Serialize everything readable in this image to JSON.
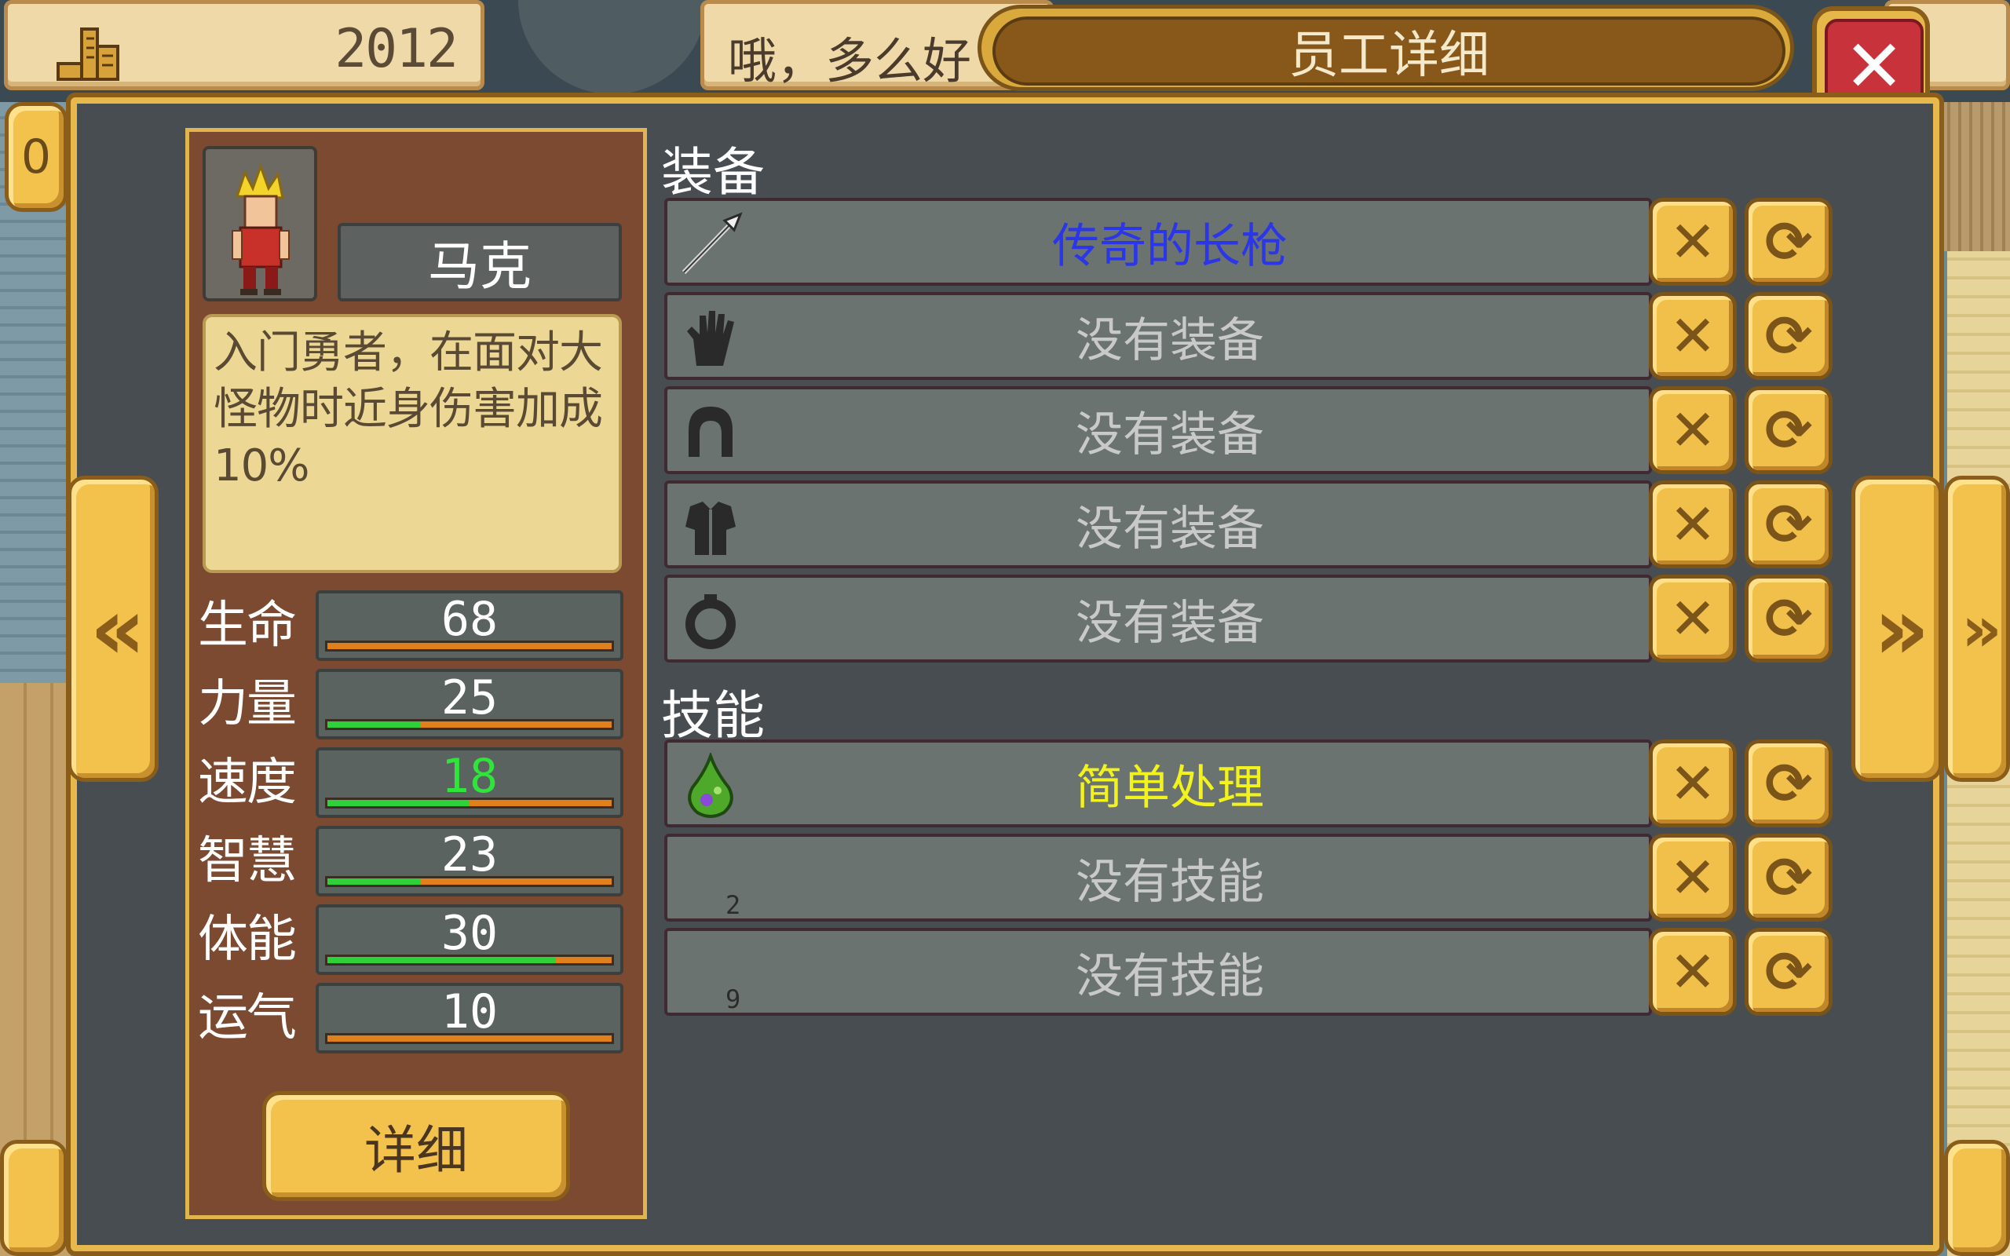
{
  "top_bar": {
    "year": "2012",
    "message": "哦，多么好"
  },
  "dialog": {
    "title": "员工详细",
    "close_symbol": "✕"
  },
  "nav": {
    "prev_symbol": "«",
    "next_symbol": "»",
    "left_edge_text": "0"
  },
  "character": {
    "name": "马克",
    "description": "入门勇者，在面对大怪物时近身伤害加成10%",
    "stats": [
      {
        "label": "生命",
        "value": "68",
        "bar_fraction": 0.0,
        "value_color": "#ffffff"
      },
      {
        "label": "力量",
        "value": "25",
        "bar_fraction": 0.33,
        "value_color": "#ffffff"
      },
      {
        "label": "速度",
        "value": "18",
        "bar_fraction": 0.5,
        "value_color": "#2fe53a"
      },
      {
        "label": "智慧",
        "value": "23",
        "bar_fraction": 0.33,
        "value_color": "#ffffff"
      },
      {
        "label": "体能",
        "value": "30",
        "bar_fraction": 0.8,
        "value_color": "#ffffff"
      },
      {
        "label": "运气",
        "value": "10",
        "bar_fraction": 0.0,
        "value_color": "#ffffff"
      }
    ],
    "detail_button": "详细"
  },
  "equipment": {
    "heading": "装备",
    "slots": [
      {
        "icon": "spear-icon",
        "text": "传奇的长枪",
        "color": "#2a36e8"
      },
      {
        "icon": "glove-icon",
        "text": "没有装备",
        "color": "#c9c9c9"
      },
      {
        "icon": "helmet-icon",
        "text": "没有装备",
        "color": "#c9c9c9"
      },
      {
        "icon": "armor-icon",
        "text": "没有装备",
        "color": "#c9c9c9"
      },
      {
        "icon": "ring-icon",
        "text": "没有装备",
        "color": "#c9c9c9"
      }
    ],
    "remove_symbol": "✕",
    "swap_symbol": "⟳"
  },
  "skills": {
    "heading": "技能",
    "slots": [
      {
        "icon": "potion-icon",
        "text": "简单处理",
        "color": "#f2f21c",
        "slot_label": ""
      },
      {
        "icon": "",
        "text": "没有技能",
        "color": "#c9c9c9",
        "slot_label": "2"
      },
      {
        "icon": "",
        "text": "没有技能",
        "color": "#c9c9c9",
        "slot_label": "9"
      }
    ]
  },
  "colors": {
    "panel_bg": "#474d51",
    "gold": "#f0c04a",
    "close_red": "#c8323a"
  }
}
